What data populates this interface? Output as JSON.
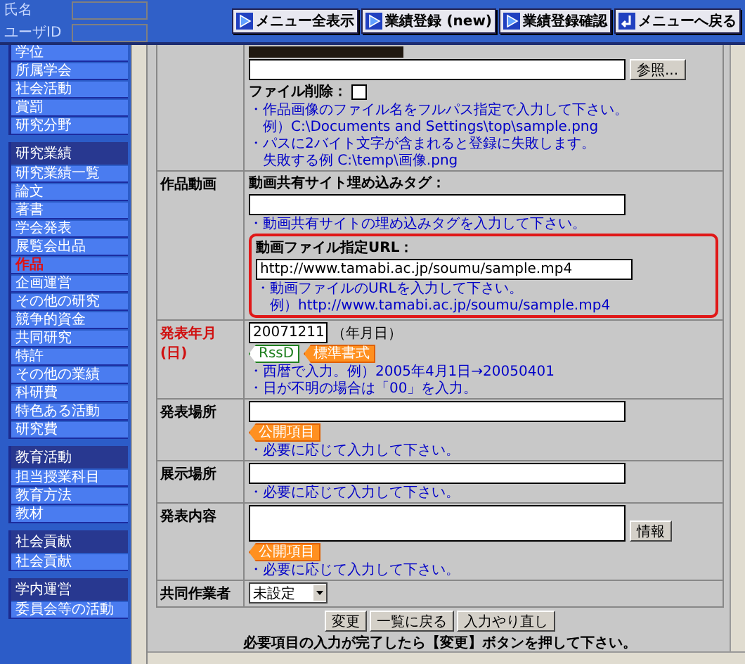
{
  "header": {
    "fields": [
      {
        "label": "氏名"
      },
      {
        "label": "ユーザID"
      }
    ],
    "buttons": [
      {
        "label": "メニュー全表示",
        "kind": "play"
      },
      {
        "label": "業績登録 (new)",
        "kind": "play"
      },
      {
        "label": "業績登録確認",
        "kind": "play"
      },
      {
        "label": "メニューへ戻る",
        "kind": "return"
      }
    ]
  },
  "sidebar": {
    "sections": [
      {
        "items": [
          {
            "label": "学位",
            "selected": false
          },
          {
            "label": "所属学会",
            "selected": false
          },
          {
            "label": "社会活動",
            "selected": false
          },
          {
            "label": "賞罰",
            "selected": false
          },
          {
            "label": "研究分野",
            "selected": false
          }
        ]
      },
      {
        "title": "研究業績",
        "items": [
          {
            "label": "研究業績一覧",
            "selected": false
          },
          {
            "label": "論文",
            "selected": false
          },
          {
            "label": "著書",
            "selected": false
          },
          {
            "label": "学会発表",
            "selected": false
          },
          {
            "label": "展覧会出品",
            "selected": false
          },
          {
            "label": "作品",
            "selected": true
          },
          {
            "label": "企画運営",
            "selected": false
          },
          {
            "label": "その他の研究",
            "selected": false
          },
          {
            "label": "競争的資金",
            "selected": false
          },
          {
            "label": "共同研究",
            "selected": false
          },
          {
            "label": "特許",
            "selected": false
          },
          {
            "label": "その他の業績",
            "selected": false
          },
          {
            "label": "科研費",
            "selected": false
          },
          {
            "label": "特色ある活動",
            "selected": false
          },
          {
            "label": "研究費",
            "selected": false
          }
        ]
      },
      {
        "title": "教育活動",
        "items": [
          {
            "label": "担当授業科目",
            "selected": false
          },
          {
            "label": "教育方法",
            "selected": false
          },
          {
            "label": "教材",
            "selected": false
          }
        ]
      },
      {
        "title": "社会貢献",
        "items": [
          {
            "label": "社会貢献",
            "selected": false
          }
        ]
      },
      {
        "title": "学内運営",
        "items": [
          {
            "label": "委員会等の活動",
            "selected": false
          }
        ]
      }
    ]
  },
  "form": {
    "rows": [
      {
        "parts": [
          {
            "kind": "photo"
          },
          {
            "kind": "file",
            "button": "参照..."
          },
          {
            "kind": "checkbox",
            "label": "ファイル削除：",
            "checked": false
          },
          {
            "kind": "note",
            "text": "・作品画像のファイル名をフルパス指定で入力して下さい。"
          },
          {
            "kind": "example",
            "text": "例）C:\\Documents and Settings\\top\\sample.png"
          },
          {
            "kind": "note",
            "text": "・パスに2バイト文字が含まれると登録に失敗します。"
          },
          {
            "kind": "example",
            "text": "失敗する例 C:\\temp\\画像.png"
          }
        ]
      },
      {
        "label": "作品動画",
        "required": false,
        "parts": [
          {
            "kind": "heading",
            "text": "動画共有サイト埋め込みタグ："
          },
          {
            "kind": "input"
          },
          {
            "kind": "note",
            "text": "・動画共有サイトの埋め込みタグを入力して下さい。"
          },
          {
            "kind": "boxed",
            "parts": [
              {
                "kind": "heading",
                "text": "動画ファイル指定URL："
              },
              {
                "kind": "input",
                "value": "http://www.tamabi.ac.jp/soumu/sample.mp4"
              },
              {
                "kind": "note",
                "text": "・動画ファイルのURLを入力して下さい。"
              },
              {
                "kind": "example",
                "text": "例）http://www.tamabi.ac.jp/soumu/sample.mp4"
              }
            ]
          }
        ]
      },
      {
        "label": "発表年月(日)",
        "required": true,
        "parts": [
          {
            "kind": "date",
            "value": "20071211",
            "unit": "（年月日）"
          },
          {
            "kind": "badges",
            "items": [
              {
                "text": "RssD",
                "kind": "green"
              },
              {
                "text": "標準書式",
                "kind": "orange"
              }
            ]
          },
          {
            "kind": "note",
            "text": "・西暦で入力。例）2005年4月1日→20050401"
          },
          {
            "kind": "note",
            "text": "・日が不明の場合は「00」を入力。"
          }
        ]
      },
      {
        "label": "発表場所",
        "required": false,
        "parts": [
          {
            "kind": "input"
          },
          {
            "kind": "badges",
            "items": [
              {
                "text": "公開項目",
                "kind": "orange"
              }
            ]
          },
          {
            "kind": "note",
            "text": "・必要に応じて入力して下さい。"
          }
        ]
      },
      {
        "label": "展示場所",
        "required": false,
        "parts": [
          {
            "kind": "input"
          },
          {
            "kind": "note",
            "text": "・必要に応じて入力して下さい。"
          }
        ]
      },
      {
        "label": "発表内容",
        "required": false,
        "parts": [
          {
            "kind": "textarea",
            "button": "情報"
          },
          {
            "kind": "badges",
            "items": [
              {
                "text": "公開項目",
                "kind": "orange"
              }
            ]
          },
          {
            "kind": "note",
            "text": "・必要に応じて入力して下さい。"
          }
        ]
      },
      {
        "label": "共同作業者",
        "required": false,
        "parts": [
          {
            "kind": "select",
            "value": "未設定"
          }
        ]
      }
    ]
  },
  "footer": {
    "buttons": [
      "変更",
      "一覧に戻る",
      "入力やり直し"
    ],
    "message": "必要項目の入力が完了したら【変更】ボタンを押して下さい。"
  }
}
